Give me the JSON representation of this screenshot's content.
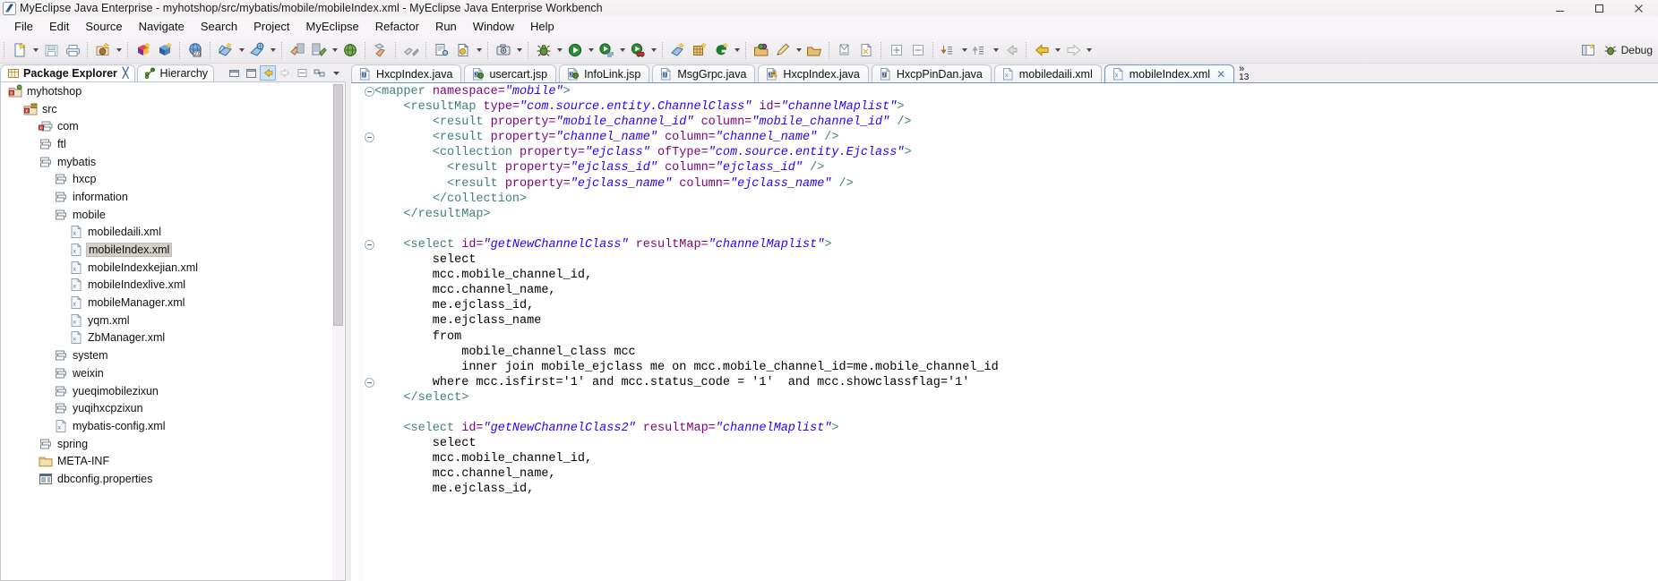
{
  "window": {
    "title": "MyEclipse Java Enterprise - myhotshop/src/mybatis/mobile/mobileIndex.xml - MyEclipse Java Enterprise Workbench",
    "app_icon": "myeclipse-logo-icon",
    "buttons": {
      "minimize": "minimize-icon",
      "maximize": "maximize-icon",
      "close": "close-icon"
    }
  },
  "menubar": {
    "items": [
      {
        "label": "File"
      },
      {
        "label": "Edit"
      },
      {
        "label": "Source"
      },
      {
        "label": "Navigate"
      },
      {
        "label": "Search"
      },
      {
        "label": "Project"
      },
      {
        "label": "MyEclipse"
      },
      {
        "label": "Refactor"
      },
      {
        "label": "Run"
      },
      {
        "label": "Window"
      },
      {
        "label": "Help"
      }
    ]
  },
  "toolbar": {
    "right_label": "Debug",
    "right_icons": [
      "perspective-open-icon",
      "debug-perspective-icon"
    ],
    "groups": [
      {
        "items": [
          {
            "icon": "new-wizard-icon",
            "arrow": true
          },
          {
            "icon": "save-icon",
            "arrow": false
          },
          {
            "icon": "print-icon",
            "arrow": false
          }
        ]
      },
      {
        "items": [
          {
            "icon": "new-java-package-icon",
            "arrow": true
          }
        ]
      },
      {
        "items": [
          {
            "icon": "new-enterprise-project-icon",
            "arrow": false
          },
          {
            "icon": "new-web-project-icon",
            "arrow": false
          }
        ]
      },
      {
        "items": [
          {
            "icon": "web20-project-icon",
            "arrow": false
          }
        ]
      },
      {
        "items": [
          {
            "icon": "deploy-icon",
            "arrow": true
          },
          {
            "icon": "run-server-icon",
            "arrow": true
          }
        ]
      },
      {
        "items": [
          {
            "icon": "db-browser-icon",
            "arrow": false
          },
          {
            "icon": "db-explorer-icon",
            "arrow": true
          },
          {
            "icon": "open-browser-icon",
            "arrow": false
          }
        ]
      },
      {
        "items": [
          {
            "icon": "report-icon",
            "arrow": false
          }
        ]
      },
      {
        "items": [
          {
            "icon": "matisse-icon",
            "arrow": false
          }
        ]
      },
      {
        "items": [
          {
            "icon": "uml-diagram-icon",
            "arrow": false
          },
          {
            "icon": "web-service-icon",
            "arrow": true
          }
        ]
      },
      {
        "items": [
          {
            "icon": "snapshot-icon",
            "arrow": true
          }
        ]
      },
      {
        "items": [
          {
            "icon": "debug-bug-icon",
            "arrow": true
          },
          {
            "icon": "run-icon",
            "arrow": true
          },
          {
            "icon": "run-config-icon",
            "arrow": true
          },
          {
            "icon": "run-profile-icon",
            "arrow": true
          }
        ]
      },
      {
        "items": [
          {
            "icon": "external-tools-icon",
            "arrow": false
          },
          {
            "icon": "new-table-icon",
            "arrow": false
          },
          {
            "icon": "genuitec-icon",
            "arrow": true
          }
        ]
      },
      {
        "items": [
          {
            "icon": "open-type-icon",
            "arrow": false
          },
          {
            "icon": "search-pencil-icon",
            "arrow": true
          },
          {
            "icon": "open-task-icon",
            "arrow": false
          }
        ]
      },
      {
        "items": [
          {
            "icon": "toggle-annotation-icon",
            "arrow": false
          },
          {
            "icon": "last-edit-icon",
            "arrow": false
          }
        ]
      },
      {
        "items": [
          {
            "icon": "expand-all-icon",
            "arrow": false
          },
          {
            "icon": "collapse-all-icon",
            "arrow": false
          }
        ]
      },
      {
        "items": [
          {
            "icon": "next-annotation-icon",
            "arrow": true
          },
          {
            "icon": "prev-annotation-icon",
            "arrow": true
          },
          {
            "icon": "back-history-grey-icon",
            "arrow": false
          }
        ]
      },
      {
        "items": [
          {
            "icon": "back-arrow-icon",
            "arrow": true
          },
          {
            "icon": "forward-arrow-icon",
            "arrow": true
          }
        ]
      }
    ]
  },
  "left_view": {
    "tabs": [
      {
        "label": "Package Explorer",
        "icon": "package-explorer-icon",
        "active": true,
        "closeable": true
      },
      {
        "label": "Hierarchy",
        "icon": "hierarchy-icon",
        "active": false,
        "closeable": false
      }
    ],
    "tool_buttons": [
      {
        "icon": "minimize-view-icon",
        "selected": false
      },
      {
        "icon": "maximize-view-icon",
        "selected": false
      },
      {
        "icon": "back-view-icon",
        "selected": true
      },
      {
        "icon": "forward-view-icon",
        "selected": false
      },
      {
        "icon": "collapse-all-view-icon",
        "selected": false
      },
      {
        "icon": "link-editor-icon",
        "selected": false
      },
      {
        "icon": "view-menu-icon",
        "selected": false
      }
    ],
    "tree": [
      {
        "label": "myhotshop",
        "depth": 0,
        "icon": "java-project-icon",
        "selected": false
      },
      {
        "label": "src",
        "depth": 1,
        "icon": "source-folder-icon",
        "selected": false
      },
      {
        "label": "com",
        "depth": 2,
        "icon": "package-red-icon",
        "selected": false
      },
      {
        "label": "ftl",
        "depth": 2,
        "icon": "package-icon",
        "selected": false
      },
      {
        "label": "mybatis",
        "depth": 2,
        "icon": "package-icon",
        "selected": false
      },
      {
        "label": "hxcp",
        "depth": 3,
        "icon": "package-icon",
        "selected": false
      },
      {
        "label": "information",
        "depth": 3,
        "icon": "package-icon",
        "selected": false
      },
      {
        "label": "mobile",
        "depth": 3,
        "icon": "package-icon",
        "selected": false
      },
      {
        "label": "mobiledaili.xml",
        "depth": 4,
        "icon": "xml-file-icon",
        "selected": false
      },
      {
        "label": "mobileIndex.xml",
        "depth": 4,
        "icon": "xml-file-icon",
        "selected": true
      },
      {
        "label": "mobileIndexkejian.xml",
        "depth": 4,
        "icon": "xml-file-icon",
        "selected": false
      },
      {
        "label": "mobileIndexlive.xml",
        "depth": 4,
        "icon": "xml-file-icon",
        "selected": false
      },
      {
        "label": "mobileManager.xml",
        "depth": 4,
        "icon": "xml-file-icon",
        "selected": false
      },
      {
        "label": "yqm.xml",
        "depth": 4,
        "icon": "xml-file-icon",
        "selected": false
      },
      {
        "label": "ZbManager.xml",
        "depth": 4,
        "icon": "xml-file-icon",
        "selected": false
      },
      {
        "label": "system",
        "depth": 3,
        "icon": "package-icon",
        "selected": false
      },
      {
        "label": "weixin",
        "depth": 3,
        "icon": "package-icon",
        "selected": false
      },
      {
        "label": "yueqimobilezixun",
        "depth": 3,
        "icon": "package-icon",
        "selected": false
      },
      {
        "label": "yuqihxcpzixun",
        "depth": 3,
        "icon": "package-icon",
        "selected": false
      },
      {
        "label": "mybatis-config.xml",
        "depth": 3,
        "icon": "xml-file-icon",
        "selected": false
      },
      {
        "label": "spring",
        "depth": 2,
        "icon": "package-icon",
        "selected": false
      },
      {
        "label": "META-INF",
        "depth": 2,
        "icon": "folder-icon",
        "selected": false
      },
      {
        "label": "dbconfig.properties",
        "depth": 2,
        "icon": "properties-file-icon",
        "selected": false
      }
    ]
  },
  "editor": {
    "tabs": [
      {
        "label": "HxcpIndex.java",
        "icon": "java-file-icon",
        "active": false
      },
      {
        "label": "usercart.jsp",
        "icon": "jsp-file-icon",
        "active": false
      },
      {
        "label": "InfoLink.jsp",
        "icon": "jsp-file-icon",
        "active": false
      },
      {
        "label": "MsgGrpc.java",
        "icon": "java-file-icon",
        "active": false
      },
      {
        "label": "HxcpIndex.java",
        "icon": "java-warn-file-icon",
        "active": false
      },
      {
        "label": "HxcpPinDan.java",
        "icon": "java-file-icon",
        "active": false
      },
      {
        "label": "mobiledaili.xml",
        "icon": "xml-file-icon",
        "active": false
      },
      {
        "label": "mobileIndex.xml",
        "icon": "xml-file-icon",
        "active": true
      }
    ],
    "overflow": {
      "chevron": "»",
      "count": "13"
    },
    "fold_markers_lines": [
      1,
      4,
      11,
      20
    ],
    "colors": {
      "tag": "#3f7f7f",
      "attr_name": "#7f007f",
      "attr_value": "#2a00ff",
      "plain": "#000000",
      "background": "#ffffff"
    },
    "code_lines": [
      [
        {
          "t": "tg",
          "s": "<mapper "
        },
        {
          "t": "at",
          "s": "namespace="
        },
        {
          "t": "av",
          "s": "\"mobile\""
        },
        {
          "t": "tg",
          "s": ">"
        }
      ],
      [
        {
          "t": "pl",
          "s": "    "
        },
        {
          "t": "tg",
          "s": "<resultMap "
        },
        {
          "t": "at",
          "s": "type="
        },
        {
          "t": "av",
          "s": "\"com.source.entity.ChannelClass\""
        },
        {
          "t": "at",
          "s": " id="
        },
        {
          "t": "av",
          "s": "\"channelMaplist\""
        },
        {
          "t": "tg",
          "s": ">"
        }
      ],
      [
        {
          "t": "pl",
          "s": "        "
        },
        {
          "t": "tg",
          "s": "<result "
        },
        {
          "t": "at",
          "s": "property="
        },
        {
          "t": "av",
          "s": "\"mobile_channel_id\""
        },
        {
          "t": "at",
          "s": " column="
        },
        {
          "t": "av",
          "s": "\"mobile_channel_id\""
        },
        {
          "t": "tg",
          "s": " />"
        }
      ],
      [
        {
          "t": "pl",
          "s": "        "
        },
        {
          "t": "tg",
          "s": "<result "
        },
        {
          "t": "at",
          "s": "property="
        },
        {
          "t": "av",
          "s": "\"channel_name\""
        },
        {
          "t": "at",
          "s": " column="
        },
        {
          "t": "av",
          "s": "\"channel_name\""
        },
        {
          "t": "tg",
          "s": " />"
        }
      ],
      [
        {
          "t": "pl",
          "s": "        "
        },
        {
          "t": "tg",
          "s": "<collection "
        },
        {
          "t": "at",
          "s": "property="
        },
        {
          "t": "av",
          "s": "\"ejclass\""
        },
        {
          "t": "at",
          "s": " ofType="
        },
        {
          "t": "av",
          "s": "\"com.source.entity.Ejclass\""
        },
        {
          "t": "tg",
          "s": ">"
        }
      ],
      [
        {
          "t": "pl",
          "s": "          "
        },
        {
          "t": "tg",
          "s": "<result "
        },
        {
          "t": "at",
          "s": "property="
        },
        {
          "t": "av",
          "s": "\"ejclass_id\""
        },
        {
          "t": "at",
          "s": " column="
        },
        {
          "t": "av",
          "s": "\"ejclass_id\""
        },
        {
          "t": "tg",
          "s": " />"
        }
      ],
      [
        {
          "t": "pl",
          "s": "          "
        },
        {
          "t": "tg",
          "s": "<result "
        },
        {
          "t": "at",
          "s": "property="
        },
        {
          "t": "av",
          "s": "\"ejclass_name\""
        },
        {
          "t": "at",
          "s": " column="
        },
        {
          "t": "av",
          "s": "\"ejclass_name\""
        },
        {
          "t": "tg",
          "s": " />"
        }
      ],
      [
        {
          "t": "pl",
          "s": "        "
        },
        {
          "t": "tg",
          "s": "</collection>"
        }
      ],
      [
        {
          "t": "pl",
          "s": "    "
        },
        {
          "t": "tg",
          "s": "</resultMap>"
        }
      ],
      [
        {
          "t": "pl",
          "s": ""
        }
      ],
      [
        {
          "t": "pl",
          "s": "    "
        },
        {
          "t": "tg",
          "s": "<select "
        },
        {
          "t": "at",
          "s": "id="
        },
        {
          "t": "av",
          "s": "\"getNewChannelClass\""
        },
        {
          "t": "at",
          "s": " resultMap="
        },
        {
          "t": "av",
          "s": "\"channelMaplist\""
        },
        {
          "t": "tg",
          "s": ">"
        }
      ],
      [
        {
          "t": "pl",
          "s": "        select"
        }
      ],
      [
        {
          "t": "pl",
          "s": "        mcc.mobile_channel_id,"
        }
      ],
      [
        {
          "t": "pl",
          "s": "        mcc.channel_name,"
        }
      ],
      [
        {
          "t": "pl",
          "s": "        me.ejclass_id,"
        }
      ],
      [
        {
          "t": "pl",
          "s": "        me.ejclass_name"
        }
      ],
      [
        {
          "t": "pl",
          "s": "        from"
        }
      ],
      [
        {
          "t": "pl",
          "s": "            mobile_channel_class mcc"
        }
      ],
      [
        {
          "t": "pl",
          "s": "            inner join mobile_ejclass me on mcc.mobile_channel_id=me.mobile_channel_id"
        }
      ],
      [
        {
          "t": "pl",
          "s": "        where mcc.isfirst='1' and mcc.status_code = '1'  and mcc.showclassflag='1'"
        }
      ],
      [
        {
          "t": "pl",
          "s": "    "
        },
        {
          "t": "tg",
          "s": "</select>"
        }
      ],
      [
        {
          "t": "pl",
          "s": ""
        }
      ],
      [
        {
          "t": "pl",
          "s": "    "
        },
        {
          "t": "tg",
          "s": "<select "
        },
        {
          "t": "at",
          "s": "id="
        },
        {
          "t": "av",
          "s": "\"getNewChannelClass2\""
        },
        {
          "t": "at",
          "s": " resultMap="
        },
        {
          "t": "av",
          "s": "\"channelMaplist\""
        },
        {
          "t": "tg",
          "s": ">"
        }
      ],
      [
        {
          "t": "pl",
          "s": "        select"
        }
      ],
      [
        {
          "t": "pl",
          "s": "        mcc.mobile_channel_id,"
        }
      ],
      [
        {
          "t": "pl",
          "s": "        mcc.channel_name,"
        }
      ],
      [
        {
          "t": "pl",
          "s": "        me.ejclass_id,"
        }
      ]
    ]
  }
}
